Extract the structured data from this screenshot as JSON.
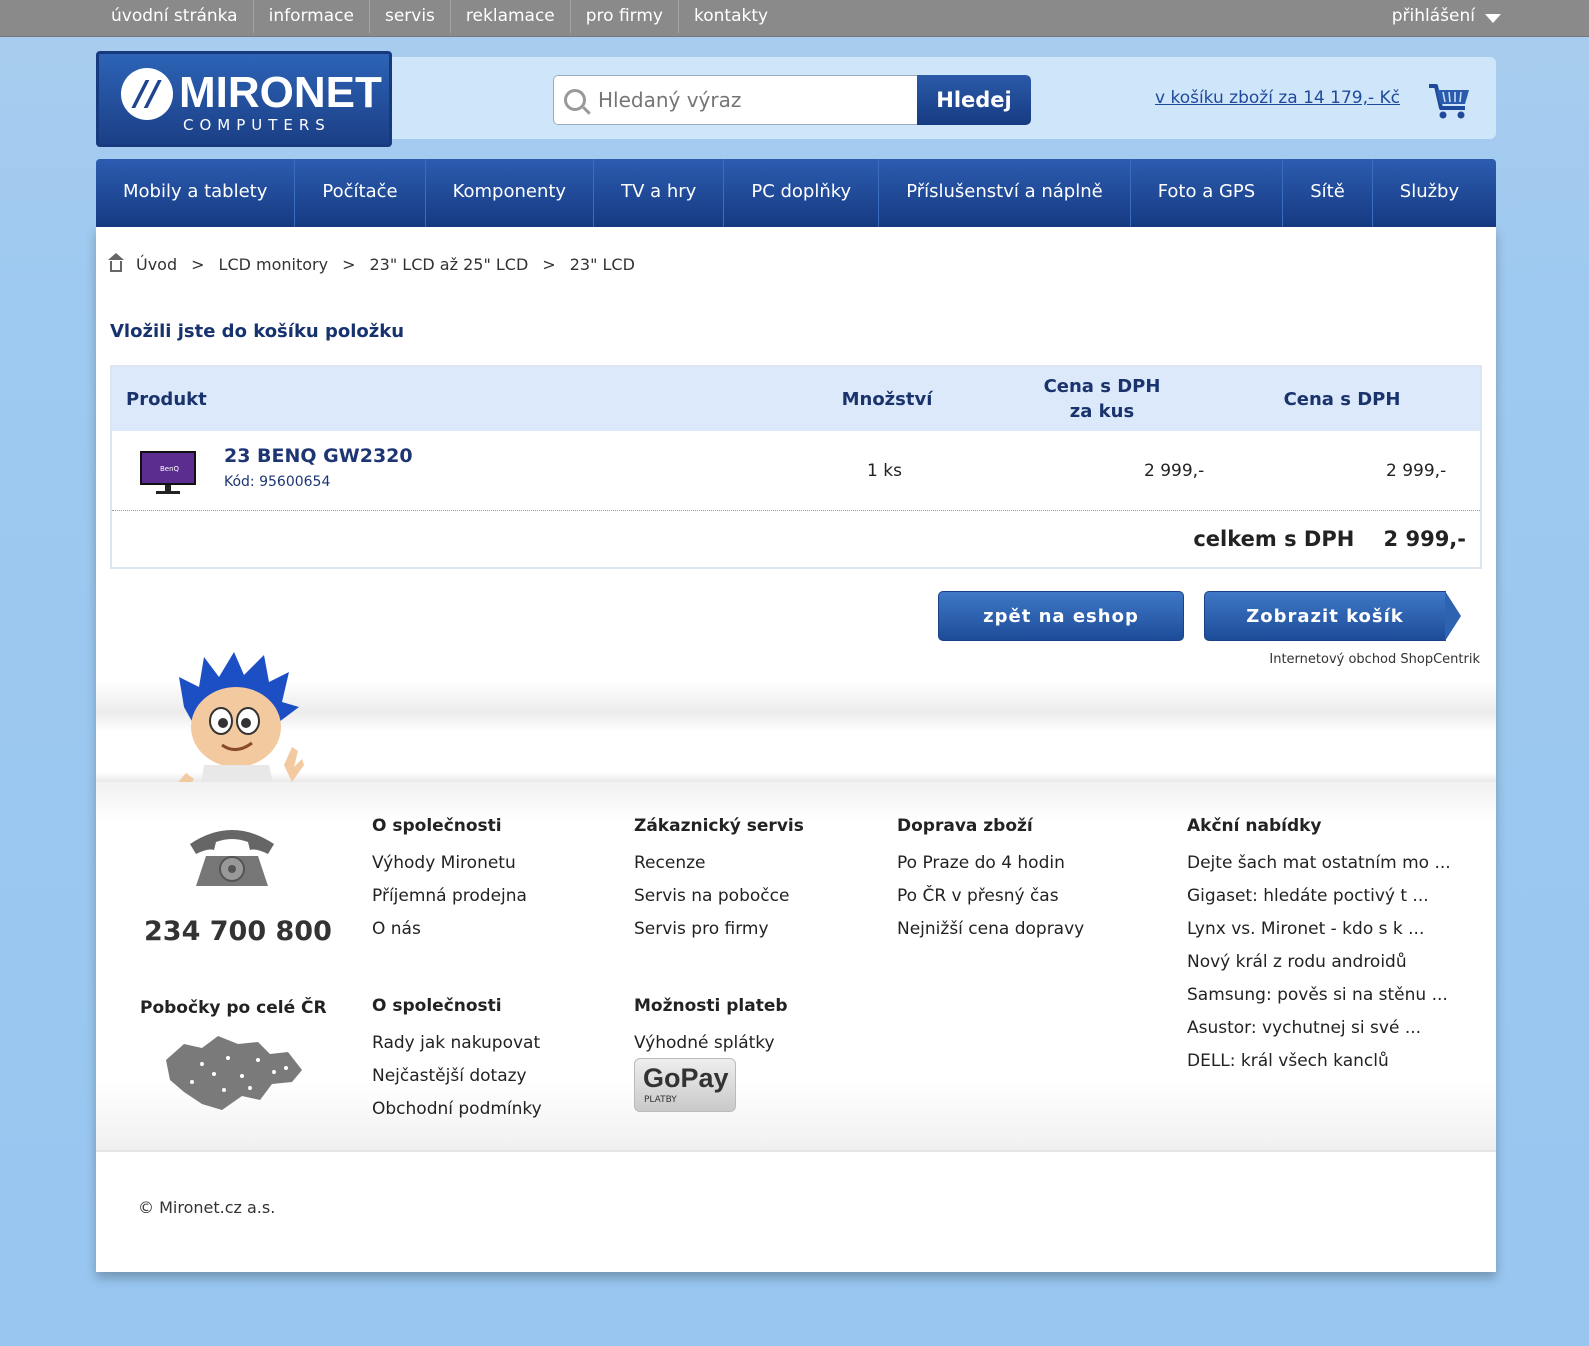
{
  "topnav": {
    "items": [
      "úvodní stránka",
      "informace",
      "servis",
      "reklamace",
      "pro firmy",
      "kontakty"
    ],
    "login": "přihlášení"
  },
  "logo": {
    "name": "MIRONET",
    "sub": "COMPUTERS"
  },
  "search": {
    "placeholder": "Hledaný výraz",
    "button": "Hledej"
  },
  "cart": {
    "link": "v košíku zboží za 14 179,- Kč"
  },
  "mainnav": [
    "Mobily a tablety",
    "Počítače",
    "Komponenty",
    "TV a hry",
    "PC doplňky",
    "Příslušenství a náplně",
    "Foto a GPS",
    "Sítě",
    "Služby"
  ],
  "breadcrumb": [
    "Úvod",
    "LCD monitory",
    "23\" LCD až 25\" LCD",
    "23\" LCD"
  ],
  "added_title": "Vložili jste do košíku položku",
  "table": {
    "headers": {
      "product": "Produkt",
      "qty": "Množství",
      "unit_price_1": "Cena s DPH",
      "unit_price_2": "za kus",
      "price": "Cena s DPH"
    },
    "row": {
      "name": "23 BENQ GW2320",
      "code": "Kód:  95600654",
      "qty": "1 ks",
      "unit_price": "2 999,-",
      "price": "2 999,-"
    },
    "total_label": "celkem s DPH",
    "total_value": "2 999,-"
  },
  "buttons": {
    "back": "zpět na eshop",
    "show_cart": "Zobrazit košík"
  },
  "shop_note": "Internetový obchod ShopCentrik",
  "footer": {
    "phone": "234 700 800",
    "branches": "Pobočky po celé ČR",
    "col1": {
      "title": "O společnosti",
      "items": [
        "Výhody Mironetu",
        "Příjemná prodejna",
        "O nás"
      ]
    },
    "col1b": {
      "title": "O společnosti",
      "items": [
        "Rady jak nakupovat",
        "Nejčastější dotazy",
        "Obchodní podmínky"
      ]
    },
    "col2": {
      "title": "Zákaznický servis",
      "items": [
        "Recenze",
        "Servis na pobočce",
        "Servis pro firmy"
      ]
    },
    "col2b": {
      "title": "Možnosti plateb",
      "items": [
        "Výhodné splátky"
      ]
    },
    "col3": {
      "title": "Doprava zboží",
      "items": [
        "Po Praze do 4 hodin",
        "Po ČR v přesný čas",
        "Nejnižší cena dopravy"
      ]
    },
    "col4": {
      "title": "Akční nabídky",
      "items": [
        "Dejte šach mat ostatním mo ...",
        "Gigaset: hledáte poctivý t ...",
        "Lynx vs. Mironet - kdo s k ...",
        "Nový král z rodu androidů",
        "Samsung: pověs si na stěnu ...",
        "Asustor: vychutnej si své ...",
        "DELL: král všech kanclů"
      ]
    },
    "gopay": {
      "name": "GoPay",
      "sub": "PLATBY"
    },
    "copyright": "© Mironet.cz a.s."
  }
}
